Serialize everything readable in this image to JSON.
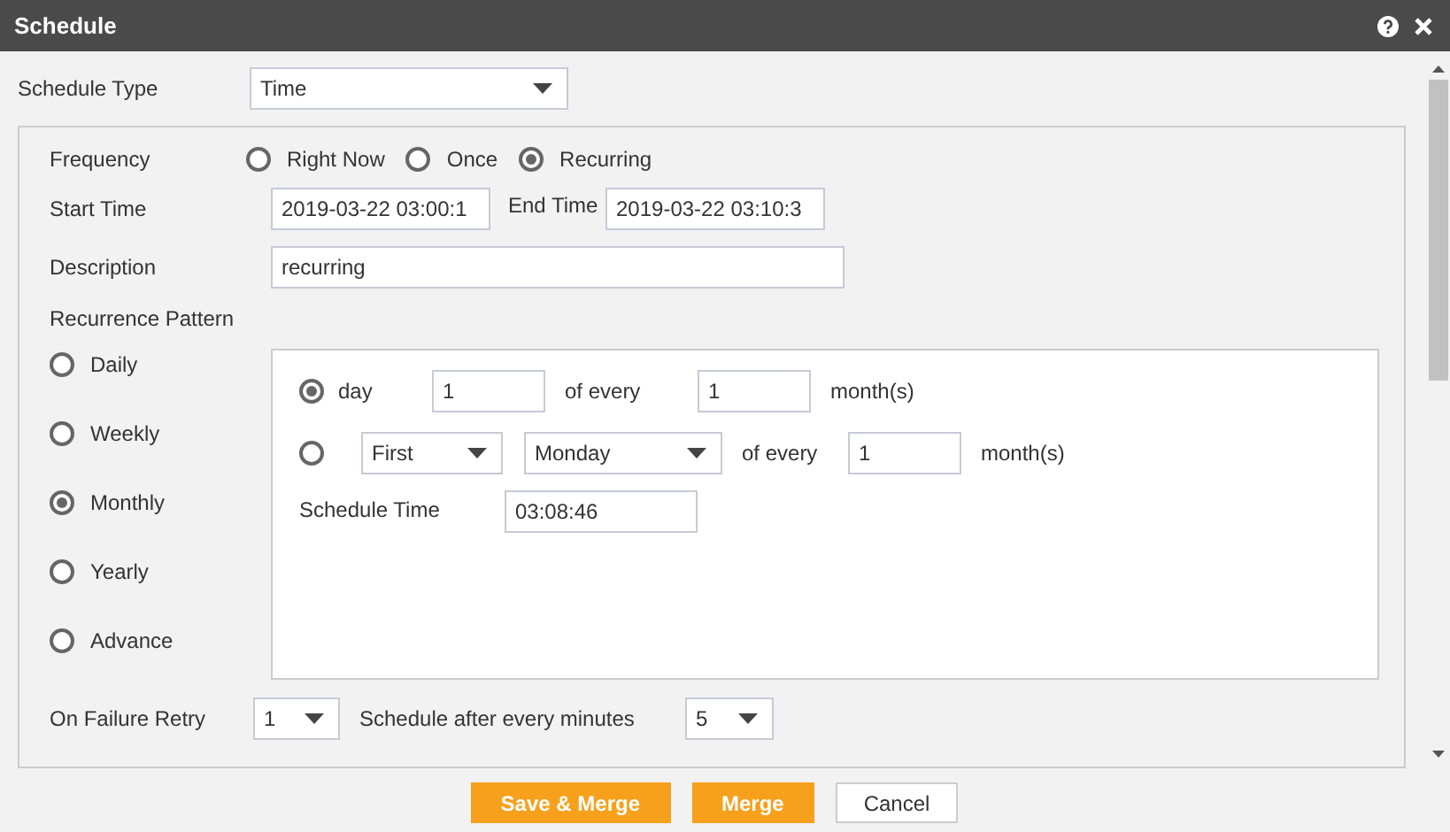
{
  "window": {
    "title": "Schedule"
  },
  "schedule_type": {
    "label": "Schedule Type",
    "value": "Time"
  },
  "frequency": {
    "label": "Frequency",
    "options": [
      {
        "label": "Right Now",
        "selected": false
      },
      {
        "label": "Once",
        "selected": false
      },
      {
        "label": "Recurring",
        "selected": true
      }
    ]
  },
  "start_time": {
    "label": "Start Time",
    "value": "2019-03-22 03:00:1"
  },
  "end_time": {
    "label": "End Time",
    "value": "2019-03-22 03:10:3"
  },
  "description": {
    "label": "Description",
    "value": "recurring"
  },
  "recurrence": {
    "label": "Recurrence Pattern",
    "patterns": [
      {
        "label": "Daily",
        "selected": false
      },
      {
        "label": "Weekly",
        "selected": false
      },
      {
        "label": "Monthly",
        "selected": true
      },
      {
        "label": "Yearly",
        "selected": false
      },
      {
        "label": "Advance",
        "selected": false
      }
    ],
    "day_option": {
      "selected": true,
      "label": "day",
      "day": "1",
      "of_every": "of every",
      "months": "1",
      "unit": "month(s)"
    },
    "weekday_option": {
      "selected": false,
      "ordinal": "First",
      "weekday": "Monday",
      "of_every": "of every",
      "months": "1",
      "unit": "month(s)"
    },
    "schedule_time": {
      "label": "Schedule Time",
      "value": "03:08:46"
    }
  },
  "retry": {
    "label": "On Failure Retry",
    "value": "1"
  },
  "interval": {
    "label": "Schedule after every minutes",
    "value": "5"
  },
  "buttons": [
    {
      "label": "Save & Merge",
      "kind": "primary"
    },
    {
      "label": "Merge",
      "kind": "primary"
    },
    {
      "label": "Cancel",
      "kind": "secondary"
    }
  ]
}
